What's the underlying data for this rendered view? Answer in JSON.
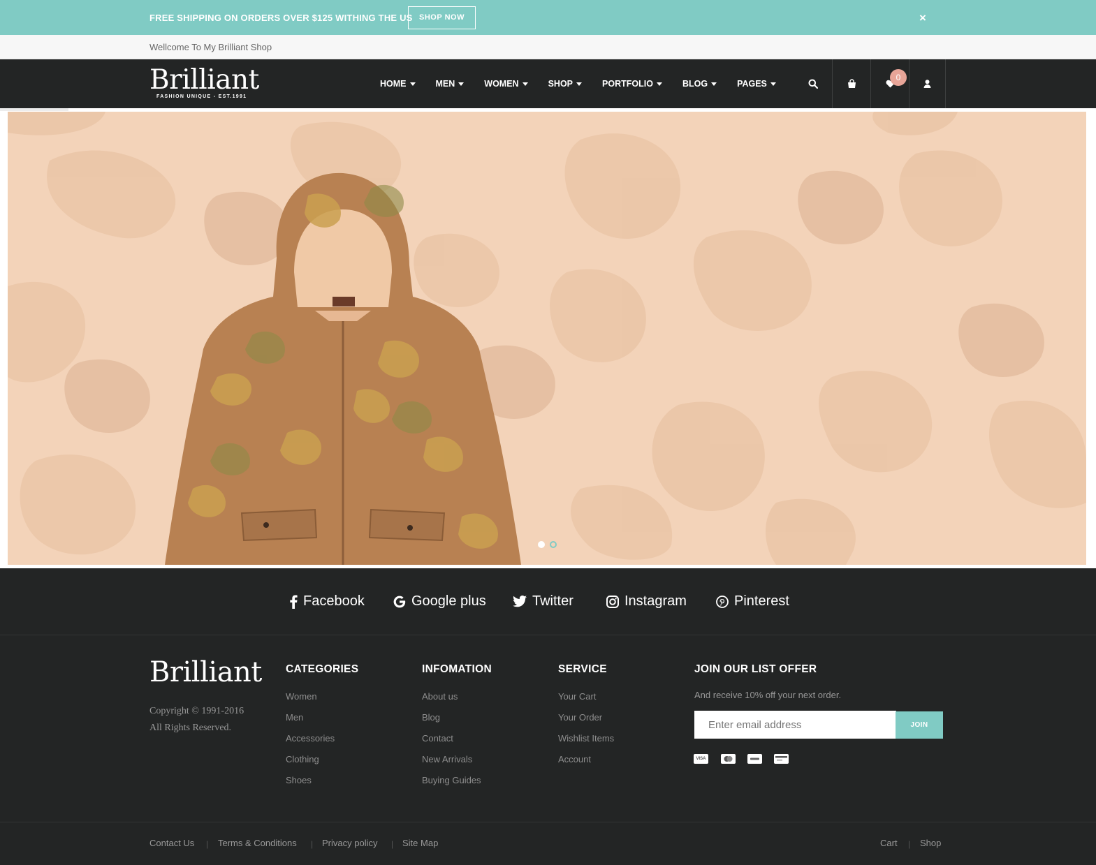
{
  "promo": {
    "text": "FREE SHIPPING ON ORDERS OVER $125 WITHING THE US",
    "button": "SHOP NOW",
    "close": "×"
  },
  "welcome": "Wellcome To My Brilliant Shop",
  "brand": {
    "name": "Brilliant",
    "tagline": "FASHION UNIQUE - EST.1991"
  },
  "nav": {
    "items": [
      "HOME",
      "MEN",
      "WOMEN",
      "SHOP",
      "PORTFOLIO",
      "BLOG",
      "PAGES"
    ],
    "wishlist_count": "0"
  },
  "hero": {
    "slides": 2,
    "active_slide": 1
  },
  "social": [
    "Facebook",
    "Google plus",
    "Twitter",
    "Instagram",
    "Pinterest"
  ],
  "footer": {
    "brand": "Brilliant",
    "copyright": "Copyright © 1991-2016",
    "rights": "All Rights Reserved.",
    "categories": {
      "title": "CATEGORIES",
      "links": [
        "Women",
        "Men",
        "Accessories",
        "Clothing",
        "Shoes"
      ]
    },
    "information": {
      "title": "INFOMATION",
      "links": [
        "About us",
        "Blog",
        "Contact",
        "New Arrivals",
        "Buying Guides"
      ]
    },
    "service": {
      "title": "SERVICE",
      "links": [
        "Your Cart",
        "Your Order",
        "Wishlist Items",
        "Account"
      ]
    },
    "newsletter": {
      "title": "JOIN OUR LIST OFFER",
      "subtitle": "And receive 10% off your next order.",
      "placeholder": "Enter email address",
      "button": "JOIN"
    },
    "payment_icons": [
      "visa-icon",
      "mastercard-icon",
      "paypal-icon",
      "card-icon"
    ]
  },
  "bottom": {
    "left_links": [
      "Contact Us",
      "Terms & Conditions",
      "Privacy policy",
      "Site Map"
    ],
    "right_links": [
      "Cart",
      "Shop"
    ]
  },
  "colors": {
    "accent": "#80cbc4",
    "dark": "#232525",
    "badge": "#e8a598",
    "hero_bg": "#f3d3b9"
  }
}
